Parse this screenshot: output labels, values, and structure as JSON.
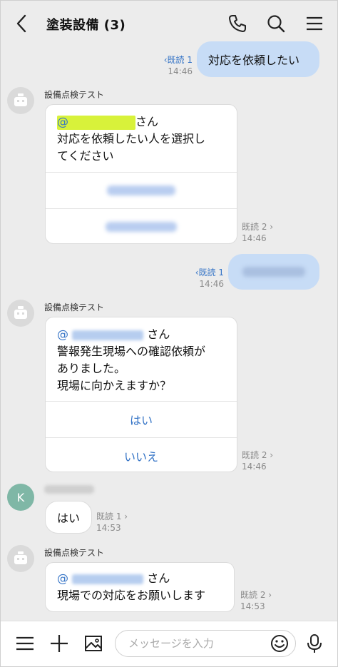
{
  "header": {
    "title": "塗装設備 (3)"
  },
  "messages": {
    "m1": {
      "text": "対応を依頼したい",
      "read": "既読 1",
      "time": "14:46"
    },
    "bot_name": "設備点検テスト",
    "card1": {
      "mention_prefix": "@",
      "mention_suffix": "さん",
      "line1": "対応を依頼したい人を選択し",
      "line2": "てください",
      "read": "既読 2",
      "time": "14:46"
    },
    "m2": {
      "read": "既読 1",
      "time": "14:46"
    },
    "card2": {
      "mention_prefix": "@",
      "mention_suffix": "さん",
      "line1": "警報発生現場への確認依頼が",
      "line2": "ありました。",
      "line3": "現場に向かえますか？",
      "yes": "はい",
      "no": "いいえ",
      "read": "既読 2",
      "time": "14:46"
    },
    "k_msg": {
      "avatar_letter": "K",
      "text": "はい",
      "read": "既読 1",
      "time": "14:53"
    },
    "card3": {
      "mention_prefix": "@",
      "mention_suffix": "さん",
      "line1": "現場での対応をお願いします",
      "read": "既読 2",
      "time": "14:53"
    }
  },
  "footer": {
    "placeholder": "メッセージを入力"
  },
  "colors": {
    "background": "#ececec",
    "outgoing_bubble": "#c7dcf6",
    "link_blue": "#3574c6",
    "mention_highlight": "#d8f23a"
  }
}
